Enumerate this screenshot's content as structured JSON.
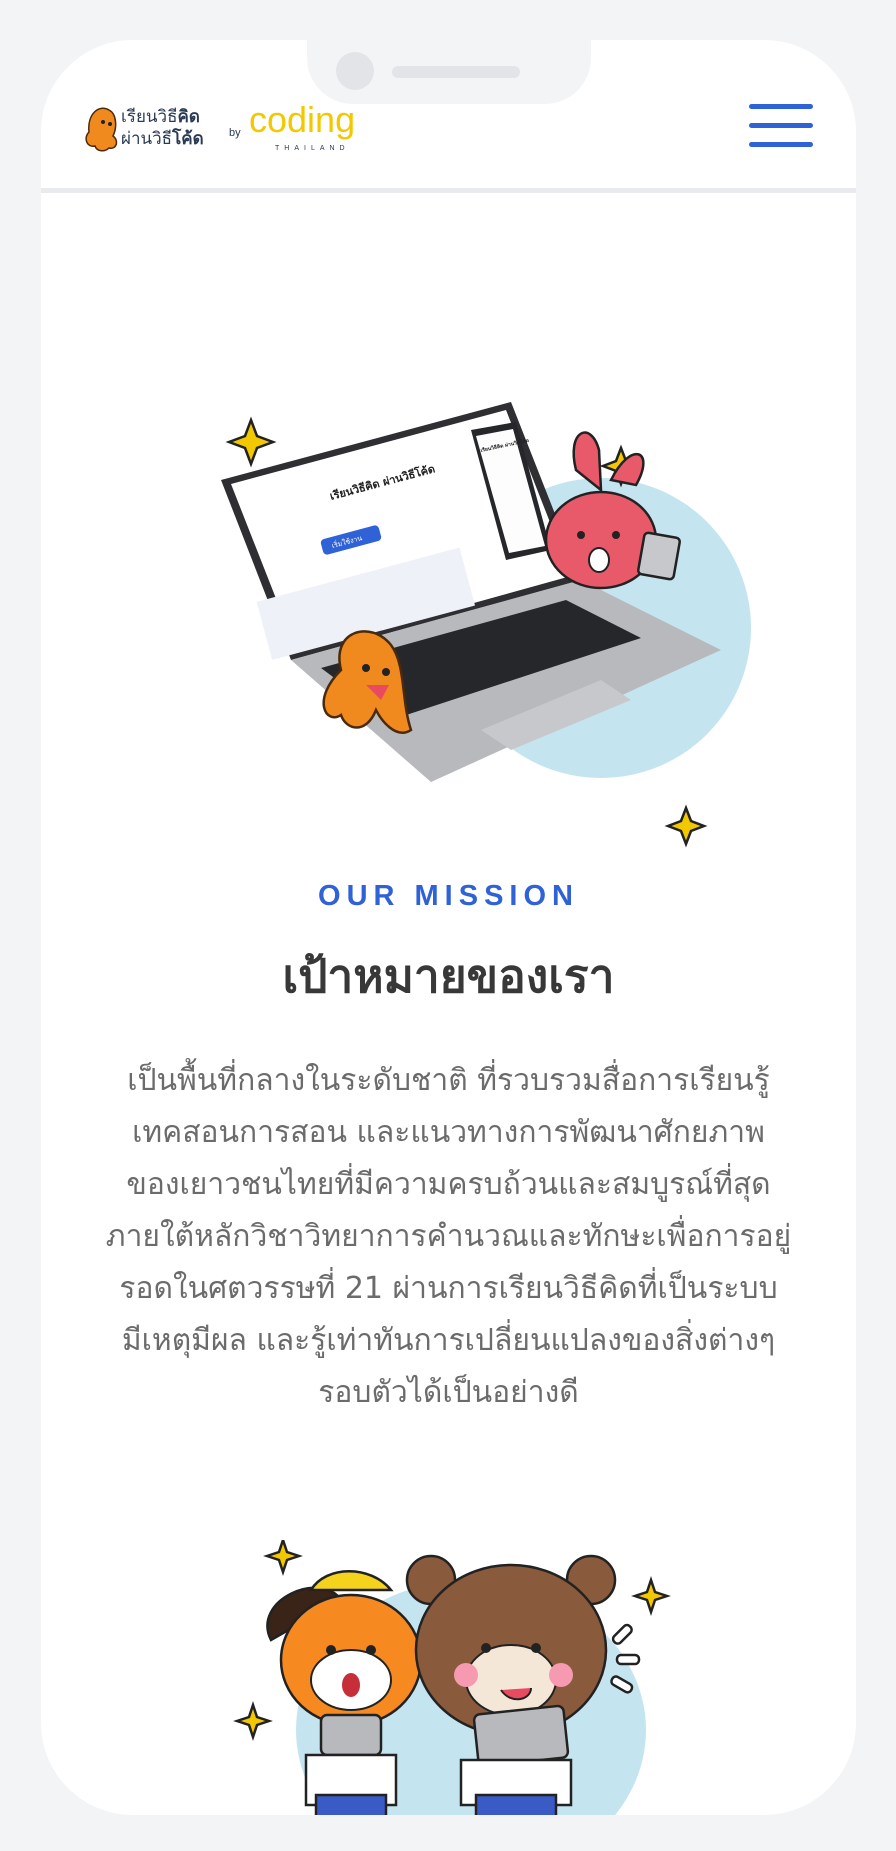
{
  "header": {
    "logo": {
      "line1_a": "เรียนวิธี",
      "line1_b": "คิด",
      "line2_a": "ผ่านวิธี",
      "line2_b": "โค้ด",
      "by": "by",
      "brand": "coding",
      "brand_sub": "THAILAND"
    },
    "menu_icon": "hamburger-menu-icon"
  },
  "hero": {
    "laptop_screen": {
      "headline": "เรียนวิธีคิด ผ่านวิธีโค้ด",
      "button": "เริ่มใช้งาน"
    },
    "phone_screen": {
      "headline": "เรียนวิธีคิด ผ่านวิธีโค้ด"
    }
  },
  "mission": {
    "eyebrow": "OUR MISSION",
    "title": "เป้าหมายของเรา",
    "lines": [
      "เป็นพื้นที่กลางในระดับชาติ ที่รวบรวมสื่อการเรียนรู้",
      "เทคสอนการสอน และแนวทางการพัฒนาศักยภาพ",
      "ของเยาวชนไทยที่มีความครบถ้วนและสมบูรณ์ที่สุด",
      "ภายใต้หลักวิชาวิทยาการคำนวณและทักษะเพื่อการอยู่",
      "รอดในศตวรรษที่ 21 ผ่านการเรียนวิธีคิดที่เป็นระบบ",
      "มีเหตุมีผล และรู้เท่าทันการเปลี่ยนแปลงของสิ่งต่างๆ",
      "รอบตัวได้เป็นอย่างดี"
    ]
  },
  "colors": {
    "accent_blue": "#2f62d6",
    "title_text": "#383838",
    "body_text": "#6b6b6b",
    "frame": "#f3f4f6",
    "brand_yellow": "#f2c800",
    "illus_bg": "#c4e5f0"
  }
}
